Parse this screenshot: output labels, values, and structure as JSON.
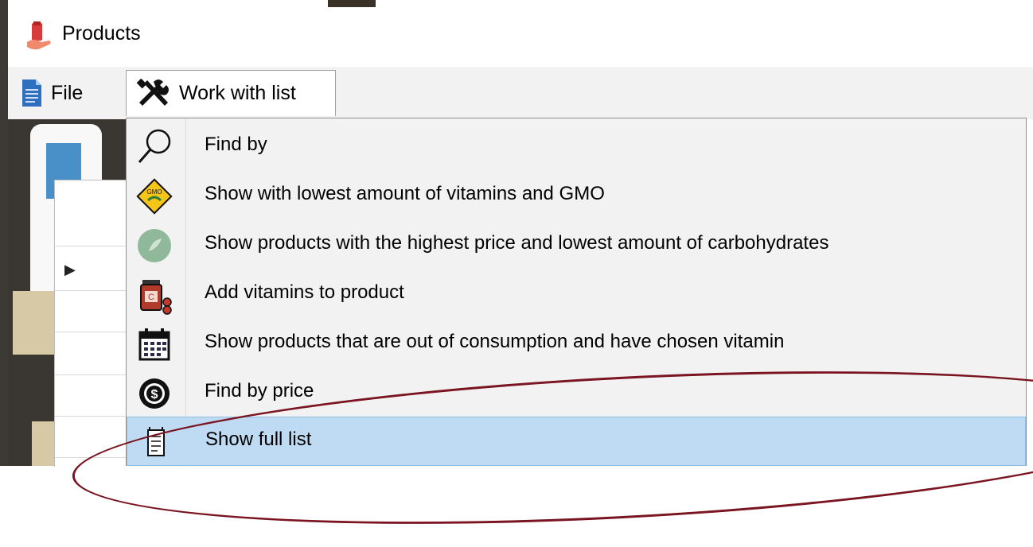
{
  "window": {
    "title": "Products"
  },
  "menubar": {
    "file_label": "File",
    "work_label": "Work with list"
  },
  "dropdown": {
    "items": [
      {
        "label": "Find by",
        "icon": "magnifier-icon"
      },
      {
        "label": "Show with lowest amount of vitamins and GMO",
        "icon": "gmo-warning-sign-icon"
      },
      {
        "label": "Show products with the highest price and lowest amount of carbohydrates",
        "icon": "green-leaf-circle-icon"
      },
      {
        "label": "Add vitamins to product",
        "icon": "vitamin-jar-icon"
      },
      {
        "label": "Show products that are out of consumption and have chosen vitamin",
        "icon": "calendar-icon"
      },
      {
        "label": "Find by price",
        "icon": "dollar-coin-icon"
      },
      {
        "label": "Show full list",
        "icon": "notepad-icon"
      }
    ],
    "selected_index": 6
  },
  "colors": {
    "highlight": "#bfdaf3",
    "annotation": "#7a1420"
  }
}
